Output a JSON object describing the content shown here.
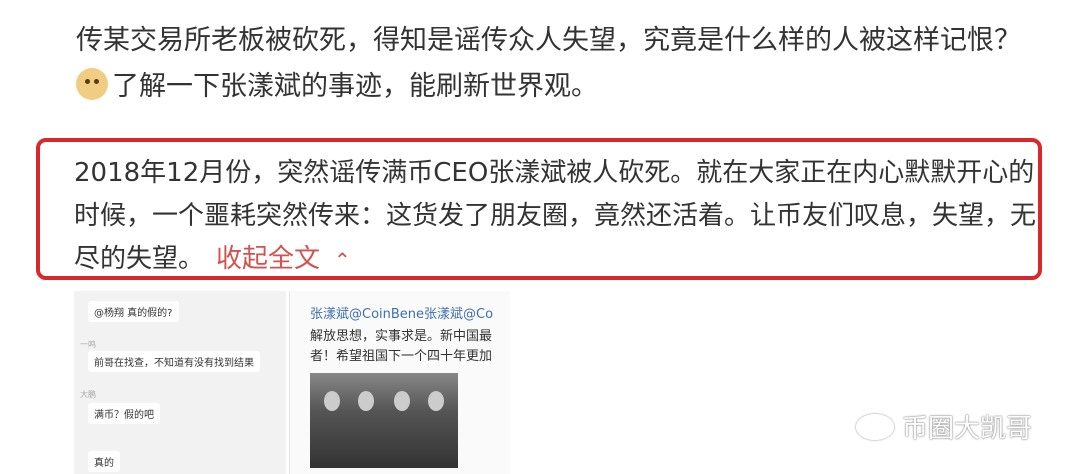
{
  "headline": {
    "line1": "传某交易所老板被砍死，得知是谣传众人失望，究竟是什么样的人被这样记恨？",
    "line2": "了解一下张漾斌的事迹，能刷新世界观。"
  },
  "highlight": {
    "text": "2018年12月份，突然谣传满币CEO张漾斌被人砍死。就在大家正在内心默默开心的时候，一个噩耗突然传来：这货发了朋友圈，竟然还活着。让币友们叹息，失望，无尽的失望。",
    "collapse_label": "收起全文",
    "caret": "⌃",
    "border_color": "#d9282b"
  },
  "chat_shot": {
    "messages": [
      {
        "name": "",
        "text": "@杨翔 真的假的?"
      },
      {
        "name": "一鸣",
        "text": "前哥在找查，不知道有没有找到结果"
      },
      {
        "name": "大鹏",
        "text": "满币？假的吧"
      },
      {
        "name": "",
        "text": "真的"
      }
    ]
  },
  "weibo_shot": {
    "name": "张漾斌@CoinBene张漾斌@Co",
    "text": "解放思想，实事求是。新中国最者！希望祖国下一个四十年更加"
  },
  "watermark": {
    "label": "币圈大凯哥"
  }
}
